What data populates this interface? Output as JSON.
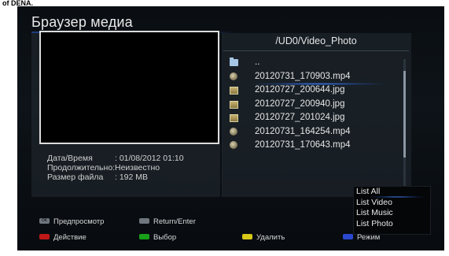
{
  "top_cutoff_text": "of DENA.",
  "window": {
    "title": "Браузер медиа"
  },
  "file_info": {
    "rows": [
      {
        "key": "Дата/Время",
        "value": ": 01/08/2012 01:10"
      },
      {
        "key": "Продолжительно:",
        "value": "Неизвестно"
      },
      {
        "key": "Размер файла",
        "value": ": 192 MB"
      }
    ]
  },
  "browser": {
    "path": "/UD0/Video_Photo",
    "items": [
      {
        "label": "..",
        "icon": "folder-icon"
      },
      {
        "label": "20120731_170903.mp4",
        "icon": "video-file-icon",
        "selected": true
      },
      {
        "label": "20120727_200644.jpg",
        "icon": "photo-file-icon"
      },
      {
        "label": "20120727_200940.jpg",
        "icon": "photo-file-icon"
      },
      {
        "label": "20120727_201024.jpg",
        "icon": "photo-file-icon"
      },
      {
        "label": "20120731_164254.mp4",
        "icon": "video-file-icon"
      },
      {
        "label": "20120731_170643.mp4",
        "icon": "video-file-icon"
      }
    ]
  },
  "filter_popup": {
    "items": [
      "List All",
      "List Video",
      "List Music",
      "List Photo"
    ],
    "active_index": 0
  },
  "hints": {
    "ok_key": "OK",
    "preview": "Предпросмотр",
    "return_enter": "Return/Enter",
    "action": "Действие",
    "select": "Выбор",
    "delete": "Удалить",
    "mode": "Режим"
  },
  "colors": {
    "red_key": "#c01818",
    "green_key": "#18a018",
    "yellow_key": "#d8c818",
    "blue_key": "#2a48d0",
    "highlight_glow": "#468cff"
  }
}
